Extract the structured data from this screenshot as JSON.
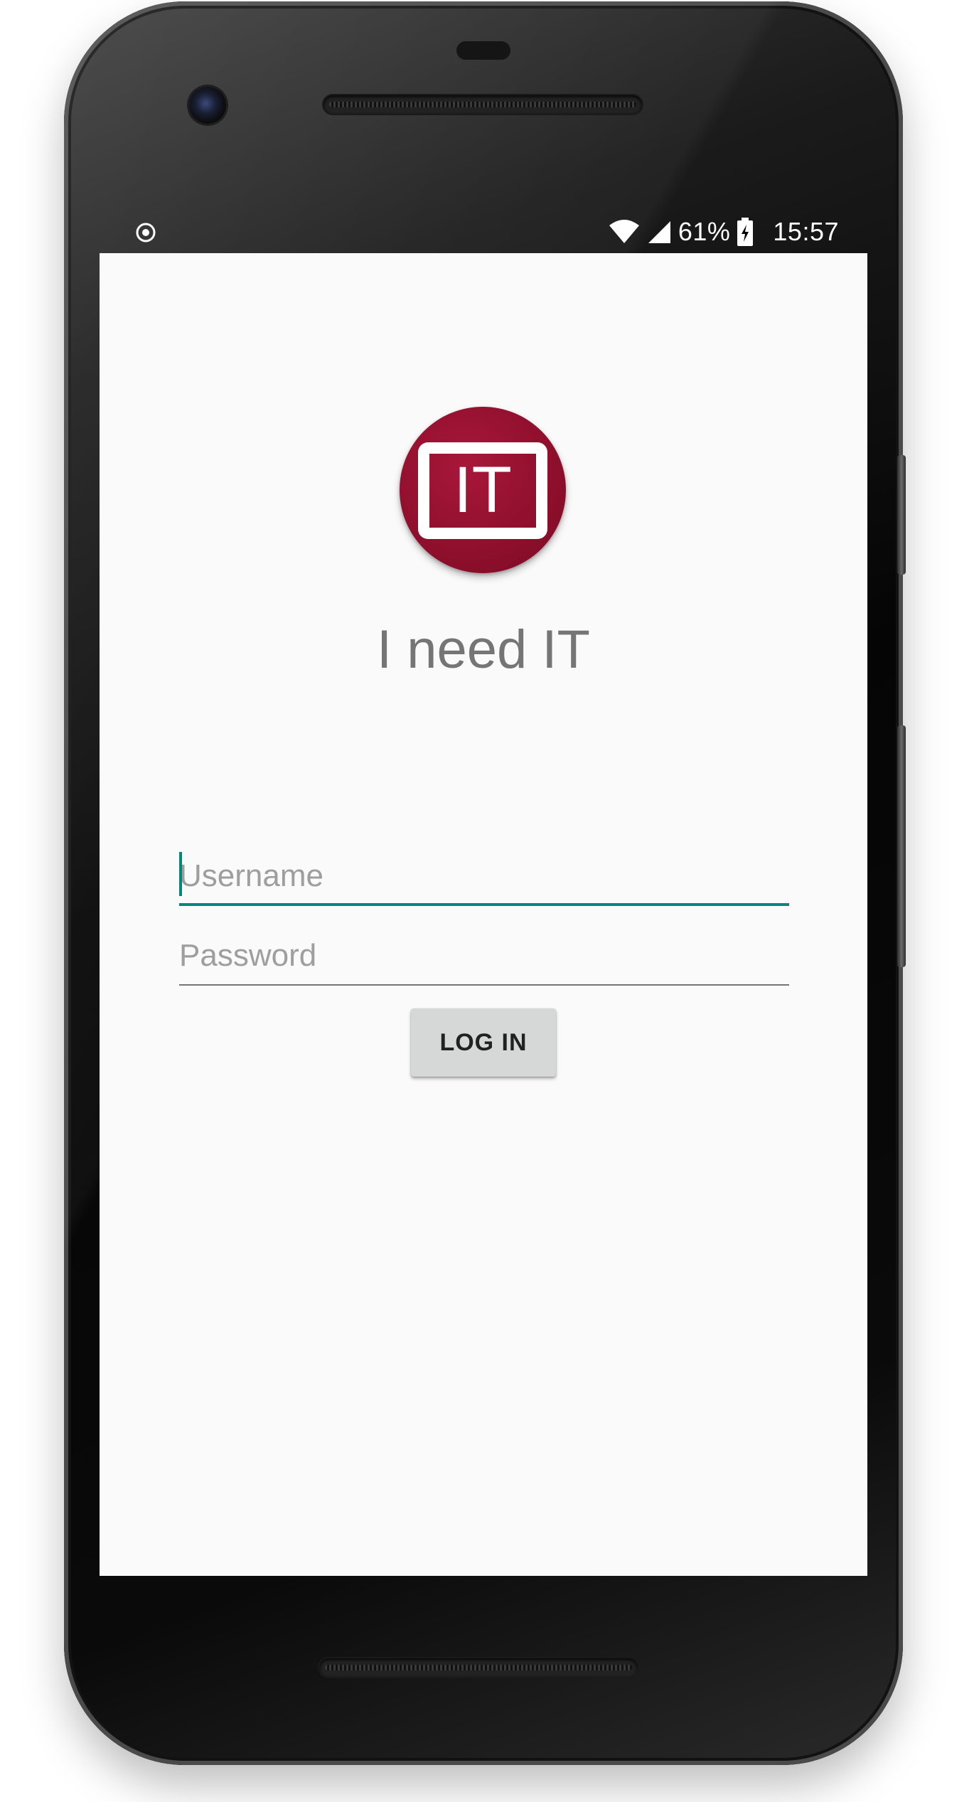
{
  "status_bar": {
    "battery": "61%",
    "time": "15:57"
  },
  "app": {
    "logo_text": "IT",
    "title": "I need IT",
    "brand_color": "#8e0f2c",
    "accent_color": "#00897b"
  },
  "login_form": {
    "username_placeholder": "Username",
    "username_value": "",
    "password_placeholder": "Password",
    "password_value": "",
    "login_button_label": "LOG IN"
  },
  "icons": {
    "status_left": "sync-record-icon",
    "wifi": "wifi-icon",
    "signal": "cell-signal-icon",
    "battery": "battery-charging-icon"
  }
}
